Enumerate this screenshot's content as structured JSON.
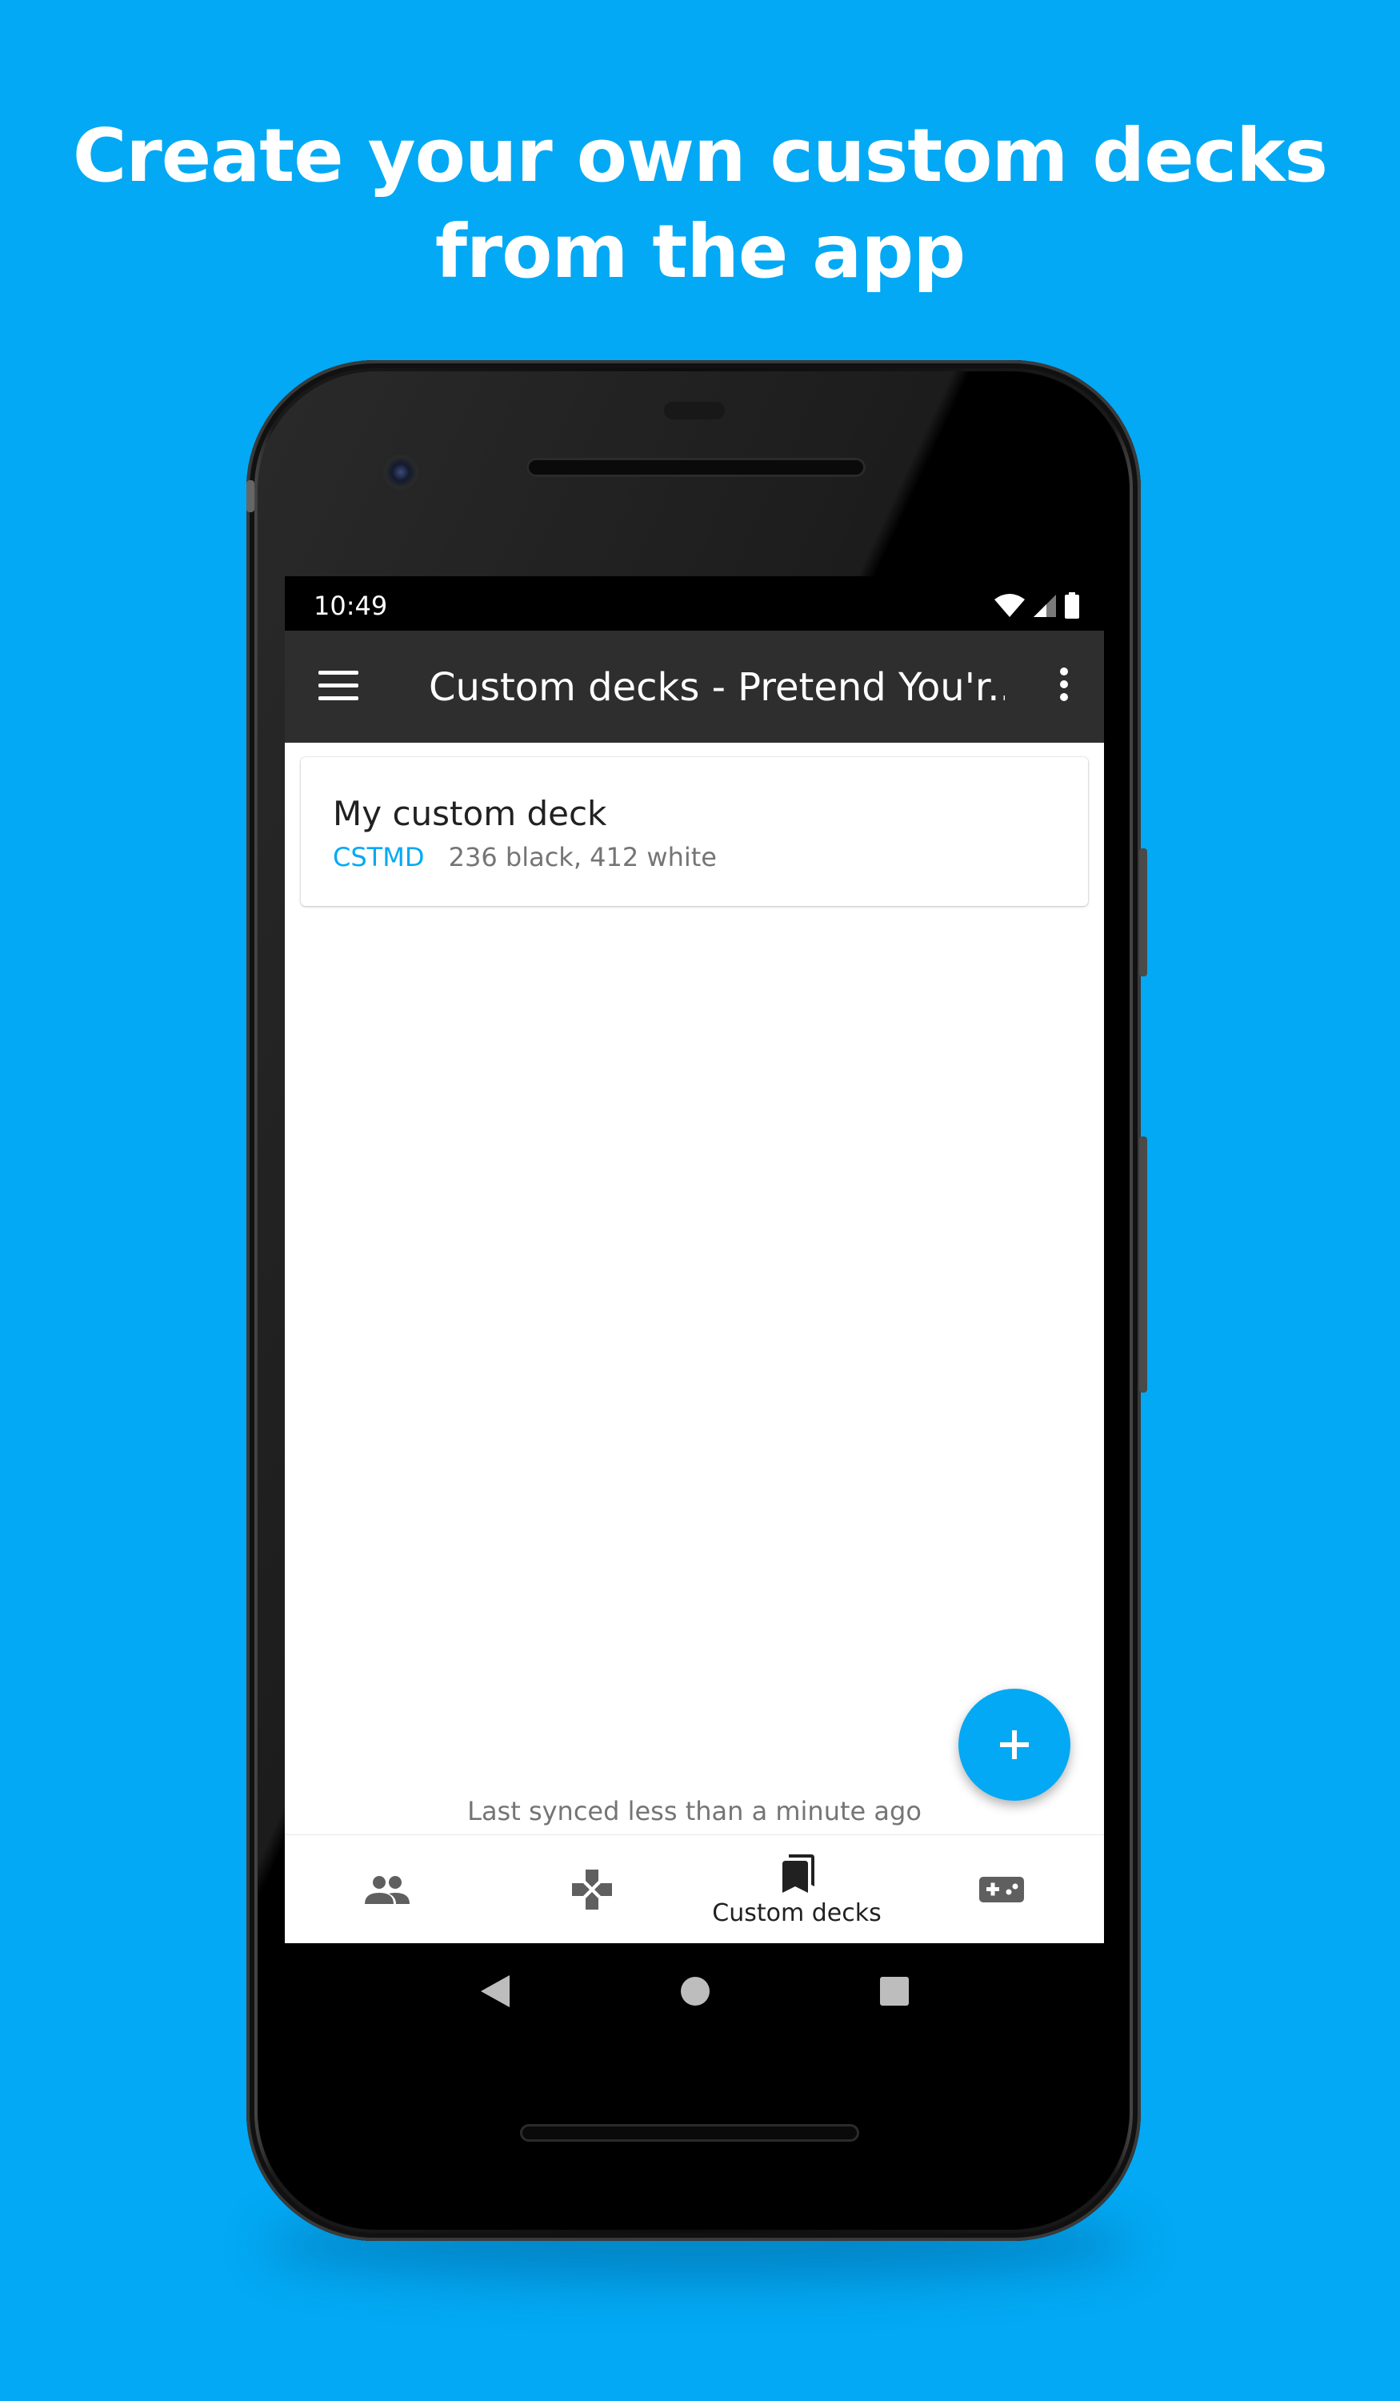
{
  "headline": {
    "line1": "Create your own custom decks",
    "line2": "from the app"
  },
  "status_bar": {
    "time": "10:49"
  },
  "app_bar": {
    "title": "Custom decks - Pretend You'r..."
  },
  "decks": [
    {
      "name": "My custom deck",
      "code": "CSTMD",
      "counts": "236 black, 412 white"
    }
  ],
  "sync_status": "Last synced less than a minute ago",
  "bottom_nav": {
    "items": [
      {
        "icon": "people-icon",
        "label": ""
      },
      {
        "icon": "dpad-icon",
        "label": ""
      },
      {
        "icon": "bookmarks-icon",
        "label": "Custom decks",
        "selected": true
      },
      {
        "icon": "gamepad-icon",
        "label": ""
      }
    ]
  },
  "colors": {
    "background": "#03a9f4",
    "accent": "#03a9f4",
    "app_bar": "#2e2e2e"
  }
}
